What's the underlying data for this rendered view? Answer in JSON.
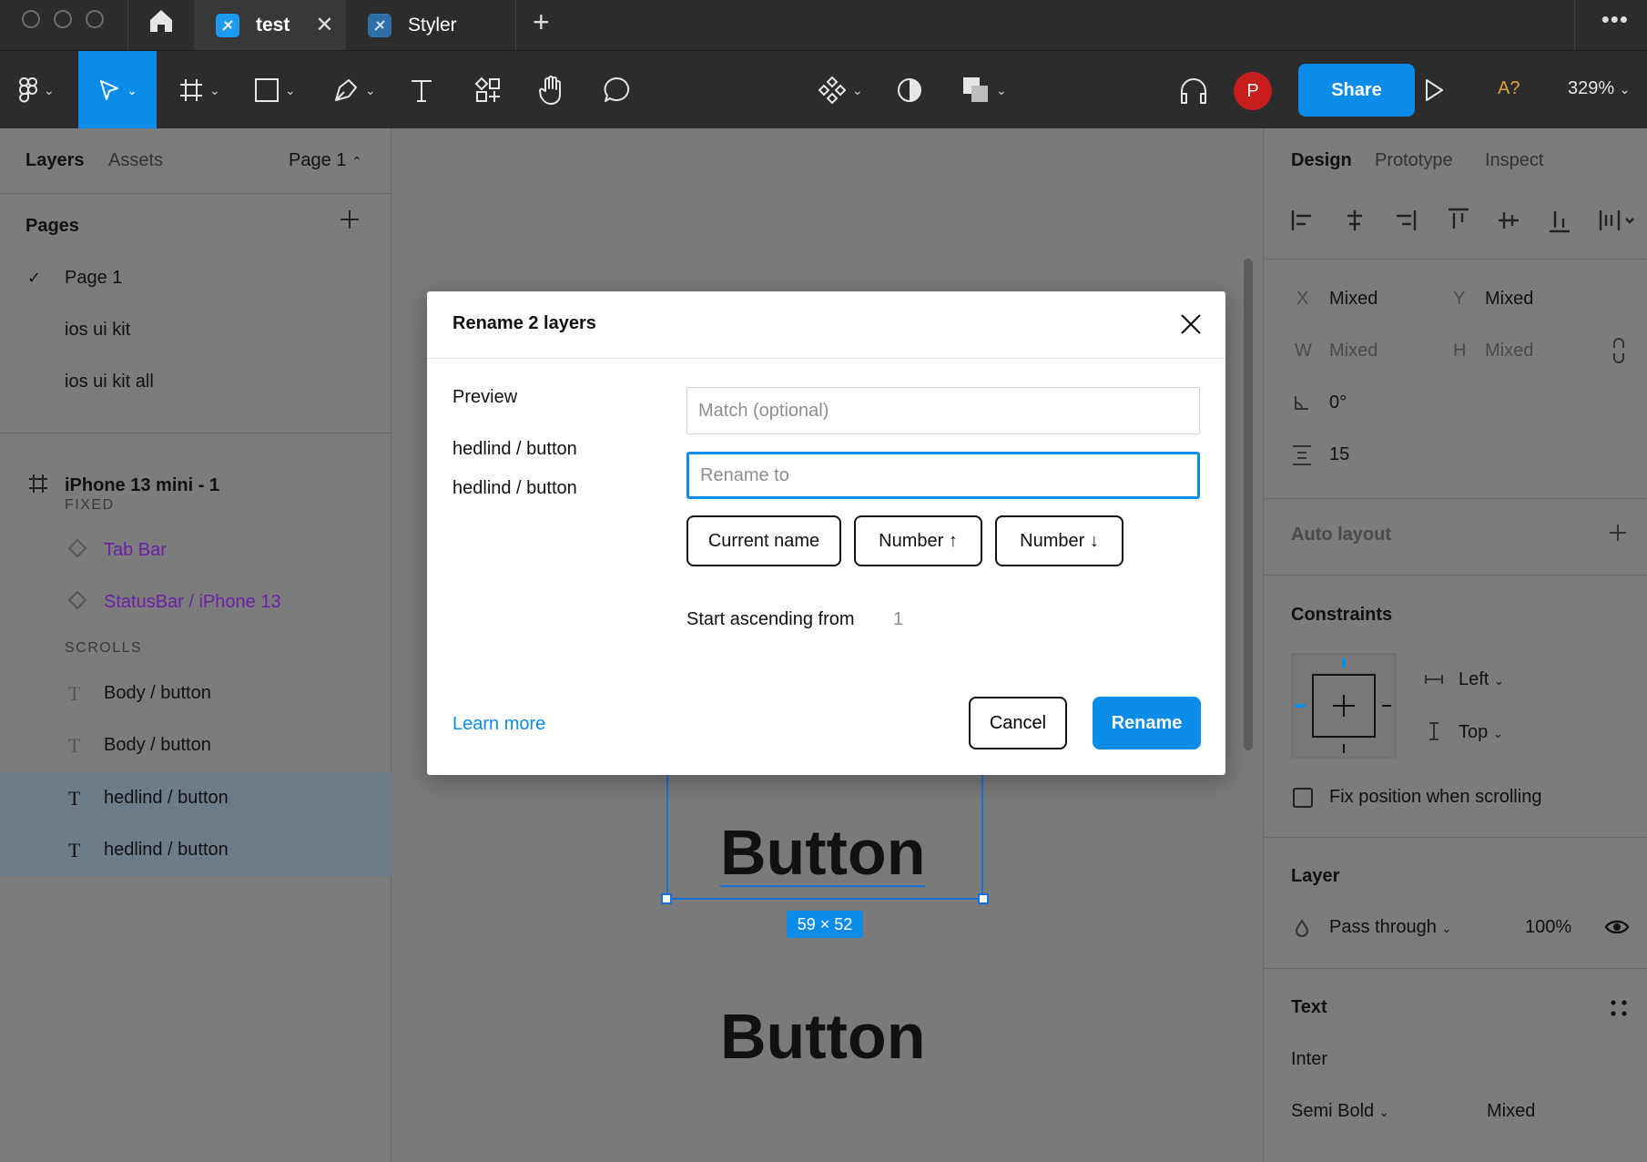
{
  "titlebar": {
    "tabs": [
      {
        "label": "test",
        "active": true
      },
      {
        "label": "Styler",
        "active": false
      }
    ]
  },
  "toolbar": {
    "avatar_initial": "P",
    "share_label": "Share",
    "a11y_label": "A?",
    "zoom": "329%"
  },
  "left_panel": {
    "tabs": [
      "Layers",
      "Assets"
    ],
    "page_selector": "Page 1",
    "pages_heading": "Pages",
    "pages": [
      "Page 1",
      "ios ui kit",
      "ios ui kit all"
    ],
    "frame_name": "iPhone 13 mini - 1",
    "section_fixed": "FIXED",
    "fixed_layers": [
      "Tab Bar",
      "StatusBar / iPhone 13"
    ],
    "section_scrolls": "SCROLLS",
    "scroll_layers": [
      "Body / button",
      "Body / button",
      "hedlind / button",
      "hedlind / button"
    ]
  },
  "canvas": {
    "text_top": "Button",
    "text_bottom": "Button",
    "size_badge": "59 × 52"
  },
  "right_panel": {
    "tabs": [
      "Design",
      "Prototype",
      "Inspect"
    ],
    "x_label": "X",
    "x_value": "Mixed",
    "y_label": "Y",
    "y_value": "Mixed",
    "w_label": "W",
    "w_value": "Mixed",
    "h_label": "H",
    "h_value": "Mixed",
    "rotation": "0°",
    "spacing": "15",
    "auto_layout": "Auto layout",
    "constraints": "Constraints",
    "constraint_h": "Left",
    "constraint_v": "Top",
    "fix_position": "Fix position when scrolling",
    "layer": "Layer",
    "blend": "Pass through",
    "opacity": "100%",
    "text": "Text",
    "font_family": "Inter",
    "font_weight": "Semi Bold",
    "font_size": "Mixed"
  },
  "modal": {
    "title": "Rename 2 layers",
    "preview_label": "Preview",
    "preview_items": [
      "hedlind / button",
      "hedlind / button"
    ],
    "match_placeholder": "Match (optional)",
    "rename_placeholder": "Rename to",
    "chips": [
      "Current name",
      "Number ↑",
      "Number ↓"
    ],
    "start_label": "Start ascending from",
    "start_value": "1",
    "learn_more": "Learn more",
    "cancel_label": "Cancel",
    "rename_label": "Rename"
  }
}
